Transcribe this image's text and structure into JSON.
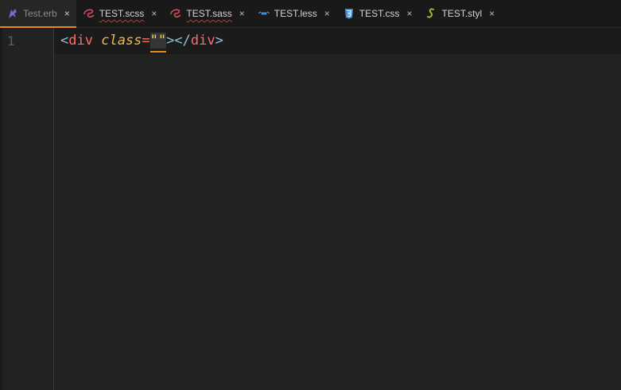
{
  "tabs": [
    {
      "label": "Test.erb",
      "icon": "erb-icon",
      "active": true,
      "squiggle": false
    },
    {
      "label": "TEST.scss",
      "icon": "sass-icon",
      "active": false,
      "squiggle": true
    },
    {
      "label": "TEST.sass",
      "icon": "sass-icon",
      "active": false,
      "squiggle": true
    },
    {
      "label": "TEST.less",
      "icon": "less-icon",
      "active": false,
      "squiggle": false
    },
    {
      "label": "TEST.css",
      "icon": "css3-icon",
      "active": false,
      "squiggle": false
    },
    {
      "label": "TEST.styl",
      "icon": "stylus-icon",
      "active": false,
      "squiggle": false
    }
  ],
  "close_glyph": "×",
  "editor": {
    "line_number": "1",
    "code": {
      "open": "<",
      "tag": "div",
      "attr": "class",
      "eq": "=",
      "quotes": "\"\"",
      "close_open": "></",
      "tag2": "div",
      "close": ">"
    }
  },
  "colors": {
    "accent": "#e68a1f",
    "tag": "#ff6b6b",
    "attr": "#f4b942",
    "punct": "#8fc1e0",
    "string": "#f0d264"
  }
}
